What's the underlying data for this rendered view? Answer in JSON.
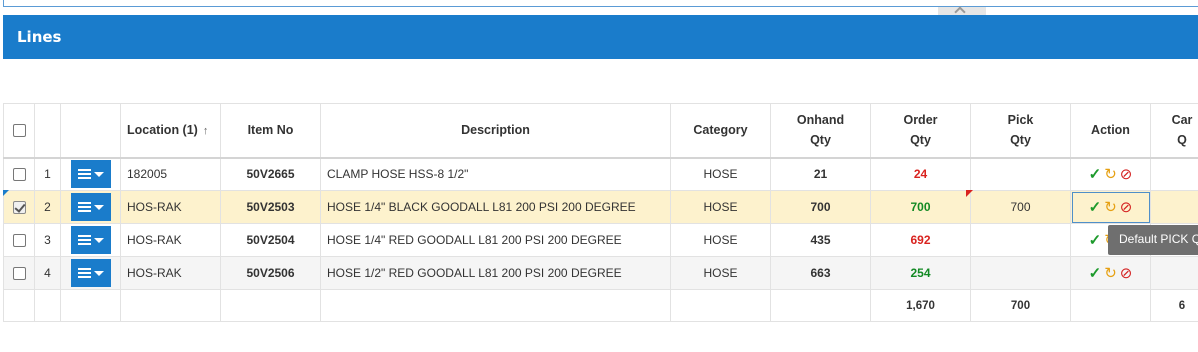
{
  "panel": {
    "title": "Lines"
  },
  "columns": {
    "location": "Location (1)",
    "item_no": "Item No",
    "description": "Description",
    "category": "Category",
    "onhand_line1": "Onhand",
    "onhand_line2": "Qty",
    "order_line1": "Order",
    "order_line2": "Qty",
    "pick_line1": "Pick",
    "pick_line2": "Qty",
    "action": "Action",
    "partial_line1": "Car",
    "partial_line2": "Q"
  },
  "rows": [
    {
      "num": "1",
      "location": "182005",
      "item_no": "50V2665",
      "description": "CLAMP HOSE HSS-8 1/2\"",
      "category": "HOSE",
      "onhand": "21",
      "order": "24",
      "order_color": "red",
      "pick": "",
      "checked": false
    },
    {
      "num": "2",
      "location": "HOS-RAK",
      "item_no": "50V2503",
      "description": "HOSE 1/4\" BLACK GOODALL L81 200 PSI 200 DEGREE",
      "category": "HOSE",
      "onhand": "700",
      "order": "700",
      "order_color": "green",
      "pick": "700",
      "checked": true
    },
    {
      "num": "3",
      "location": "HOS-RAK",
      "item_no": "50V2504",
      "description": "HOSE 1/4\" RED GOODALL L81 200 PSI 200 DEGREE",
      "category": "HOSE",
      "onhand": "435",
      "order": "692",
      "order_color": "red",
      "pick": "",
      "checked": false
    },
    {
      "num": "4",
      "location": "HOS-RAK",
      "item_no": "50V2506",
      "description": "HOSE 1/2\" RED GOODALL L81 200 PSI 200 DEGREE",
      "category": "HOSE",
      "onhand": "663",
      "order": "254",
      "order_color": "green",
      "pick": "",
      "checked": false
    }
  ],
  "totals": {
    "order": "1,670",
    "pick": "700",
    "partial": "6"
  },
  "tooltip": {
    "text": "Default PICK Q"
  },
  "icons": {
    "sort": "arrow-up-icon",
    "row_menu": "list-menu-icon",
    "confirm": "check-icon",
    "undo": "undo-icon",
    "cancel": "cancel-icon"
  },
  "colors": {
    "header_blue": "#1a7ccb",
    "selected_row": "#fdf2cd",
    "qty_red": "#d9231f",
    "qty_green": "#138a24"
  }
}
